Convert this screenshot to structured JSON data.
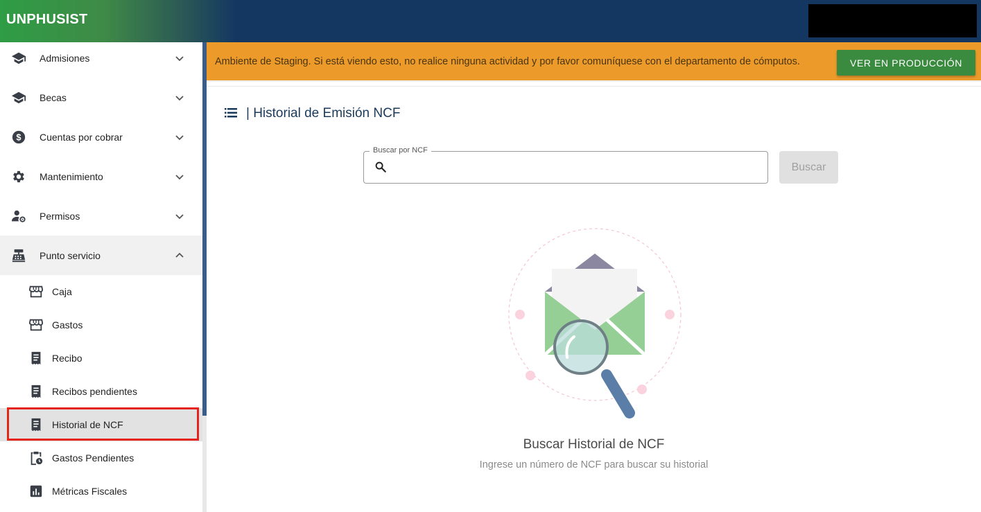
{
  "app": {
    "brand": "UNPHUSIST"
  },
  "sidebar": {
    "groups": [
      {
        "label": "Admisiones",
        "icon": "graduation-cap-icon",
        "open": false
      },
      {
        "label": "Becas",
        "icon": "graduation-cap-icon",
        "open": false
      },
      {
        "label": "Cuentas por cobrar",
        "icon": "dollar-circle-icon",
        "open": false
      },
      {
        "label": "Mantenimiento",
        "icon": "gear-icon",
        "open": false
      },
      {
        "label": "Permisos",
        "icon": "user-gear-icon",
        "open": false
      },
      {
        "label": "Punto servicio",
        "icon": "cash-register-icon",
        "open": true
      }
    ],
    "sub_items": [
      {
        "label": "Caja",
        "icon": "store-icon"
      },
      {
        "label": "Gastos",
        "icon": "store-icon"
      },
      {
        "label": "Recibo",
        "icon": "receipt-icon"
      },
      {
        "label": "Recibos pendientes",
        "icon": "receipt-icon"
      },
      {
        "label": "Historial de NCF",
        "icon": "receipt-icon",
        "active": true
      },
      {
        "label": "Gastos Pendientes",
        "icon": "clipboard-clock-icon"
      },
      {
        "label": "Métricas Fiscales",
        "icon": "bar-chart-icon"
      }
    ]
  },
  "banner": {
    "text": "Ambiente de Staging. Si está viendo esto, no realice ninguna actividad y por favor comuníquese con el departamento de cómputos.",
    "button_label": "VER EN PRODUCCIÓN",
    "color": "#ec9b2b"
  },
  "page": {
    "title": "| Historial de Emisión NCF",
    "search": {
      "legend": "Buscar por NCF",
      "value": "",
      "button_label": "Buscar"
    },
    "empty_state": {
      "title": "Buscar Historial de NCF",
      "subtitle": "Ingrese un número de NCF para buscar su historial"
    }
  },
  "colors": {
    "topbar": "#143762",
    "accent_green": "#3a8a3f",
    "highlight_border": "#e5251c"
  }
}
